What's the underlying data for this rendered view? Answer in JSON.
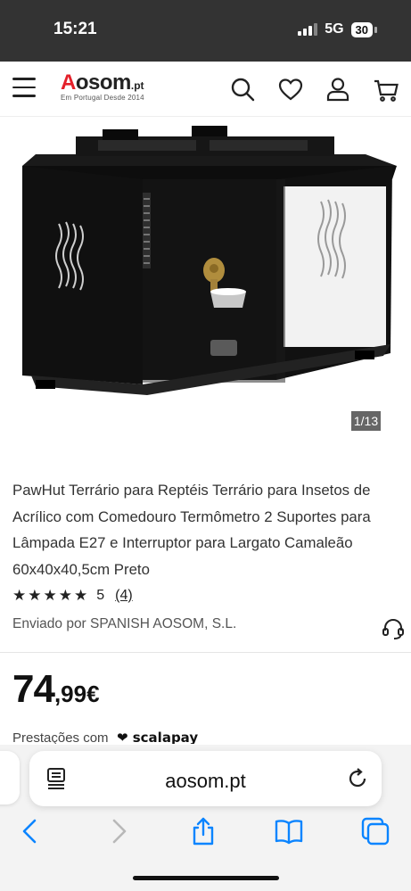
{
  "status_bar": {
    "time": "15:21",
    "network": "5G",
    "battery": "30"
  },
  "header": {
    "logo": {
      "brand_a": "A",
      "brand_rest": "osom",
      "tld": ".pt",
      "tagline": "Em Portugal Desde 2014"
    },
    "icons": [
      "menu-icon",
      "search-icon",
      "heart-icon",
      "user-icon",
      "cart-icon"
    ]
  },
  "gallery": {
    "counter": "1/13"
  },
  "product": {
    "title": "PawHut Terrário para Reptéis Terrário para Insetos de Acrílico com Comedouro Termômetro 2 Suportes para Lâmpada E27 e Interruptor para Largato Camaleão 60x40x40,5cm Preto",
    "stars": "★★★★★",
    "rating_value": "5",
    "rating_count": "(4)",
    "seller": "Enviado por SPANISH AOSOM, S.L.",
    "price_int": "74",
    "price_dec": ",99€",
    "installments_label": "Prestações com",
    "installments_brand": "scalapay"
  },
  "browser": {
    "url": "aosom.pt",
    "toolbar": [
      "back-icon",
      "forward-icon",
      "share-icon",
      "bookmarks-icon",
      "tabs-icon"
    ]
  },
  "colors": {
    "brand_red": "#e4202a",
    "ios_blue": "#0a84ff",
    "status_bar_bg": "#333333"
  }
}
